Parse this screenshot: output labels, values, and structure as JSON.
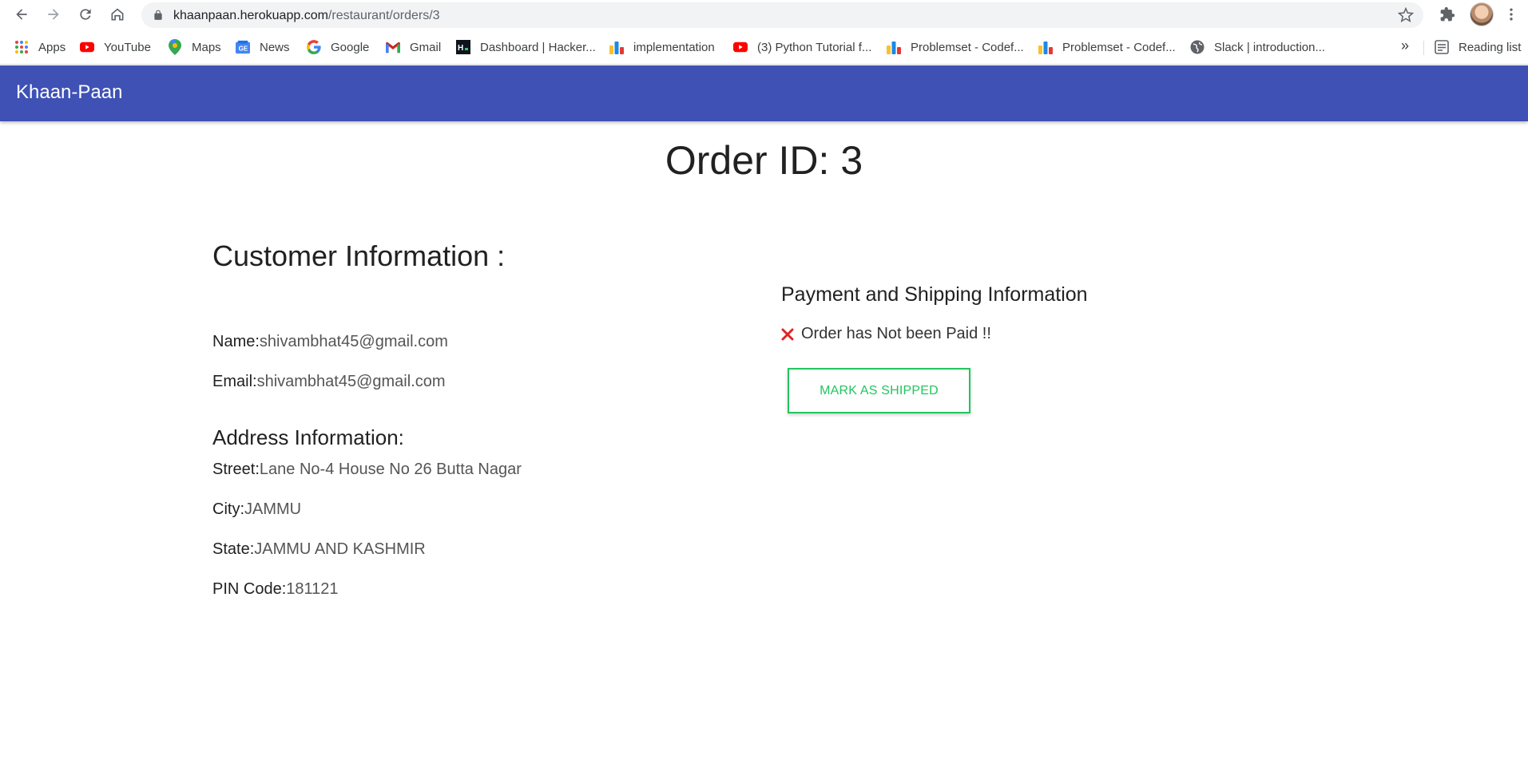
{
  "browser": {
    "url_host": "khaanpaan.herokuapp.com",
    "url_path": "/restaurant/orders/3",
    "bookmarks": [
      {
        "label": "Apps",
        "icon": "apps-grid-icon"
      },
      {
        "label": "YouTube",
        "icon": "youtube-icon"
      },
      {
        "label": "Maps",
        "icon": "maps-pin-icon"
      },
      {
        "label": "News",
        "icon": "news-icon"
      },
      {
        "label": "Google",
        "icon": "google-icon"
      },
      {
        "label": "Gmail",
        "icon": "gmail-icon"
      },
      {
        "label": "Dashboard | Hacker...",
        "icon": "hackerrank-icon"
      },
      {
        "label": "implementation",
        "icon": "codeforces-icon"
      },
      {
        "label": "(3) Python Tutorial f...",
        "icon": "youtube-icon"
      },
      {
        "label": "Problemset - Codef...",
        "icon": "codeforces-icon"
      },
      {
        "label": "Problemset - Codef...",
        "icon": "codeforces-icon"
      },
      {
        "label": "Slack | introduction...",
        "icon": "globe-icon"
      }
    ],
    "more_label": "»",
    "reading_list": "Reading list"
  },
  "app": {
    "brand": "Khaan-Paan",
    "brand_color": "#3f51b5"
  },
  "order": {
    "title": "Order ID: 3",
    "customer_heading": "Customer Information :",
    "name_label": "Name:",
    "name_value": "shivambhat45@gmail.com",
    "email_label": "Email:",
    "email_value": "shivambhat45@gmail.com",
    "address_heading": "Address Information:",
    "street_label": "Street:",
    "street_value": "Lane No-4 House No 26 Butta Nagar",
    "city_label": "City:",
    "city_value": "JAMMU",
    "state_label": "State:",
    "state_value": "JAMMU AND KASHMIR",
    "pin_label": "PIN Code:",
    "pin_value": "181121"
  },
  "payment": {
    "heading": "Payment and Shipping Information",
    "status_icon": "close-x-icon",
    "status_color": "#e02424",
    "status_text": "Order has Not been Paid !!",
    "ship_button": "MARK AS SHIPPED",
    "ship_color": "#22c55e"
  }
}
